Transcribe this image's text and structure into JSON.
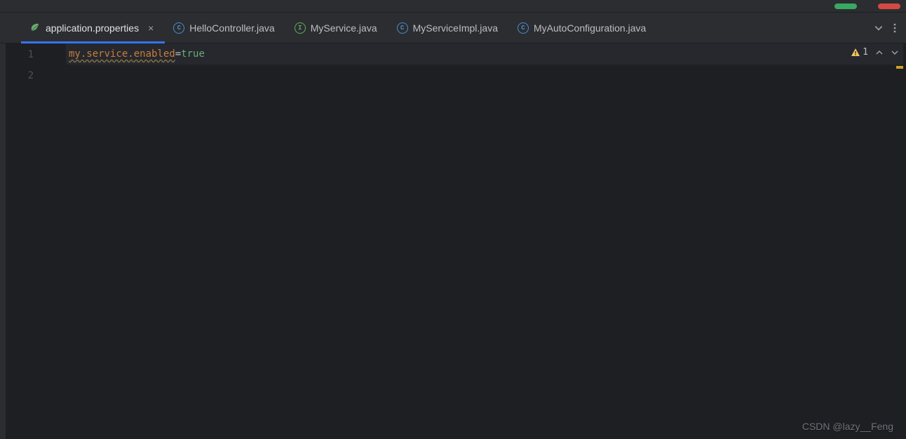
{
  "tabs": [
    {
      "label": "application.properties",
      "icon": "leaf",
      "active": true,
      "closeable": true
    },
    {
      "label": "HelloController.java",
      "icon": "class-blue",
      "active": false
    },
    {
      "label": "MyService.java",
      "icon": "interface-green",
      "active": false
    },
    {
      "label": "MyServiceImpl.java",
      "icon": "class-blue",
      "active": false
    },
    {
      "label": "MyAutoConfiguration.java",
      "icon": "class-blue",
      "active": false
    }
  ],
  "editor": {
    "lines": {
      "1": {
        "number": "1",
        "key": "my.service.enabled",
        "eq": "=",
        "value": "true"
      },
      "2": {
        "number": "2"
      }
    },
    "warning_count": "1"
  },
  "watermark": "CSDN @lazy__Feng"
}
